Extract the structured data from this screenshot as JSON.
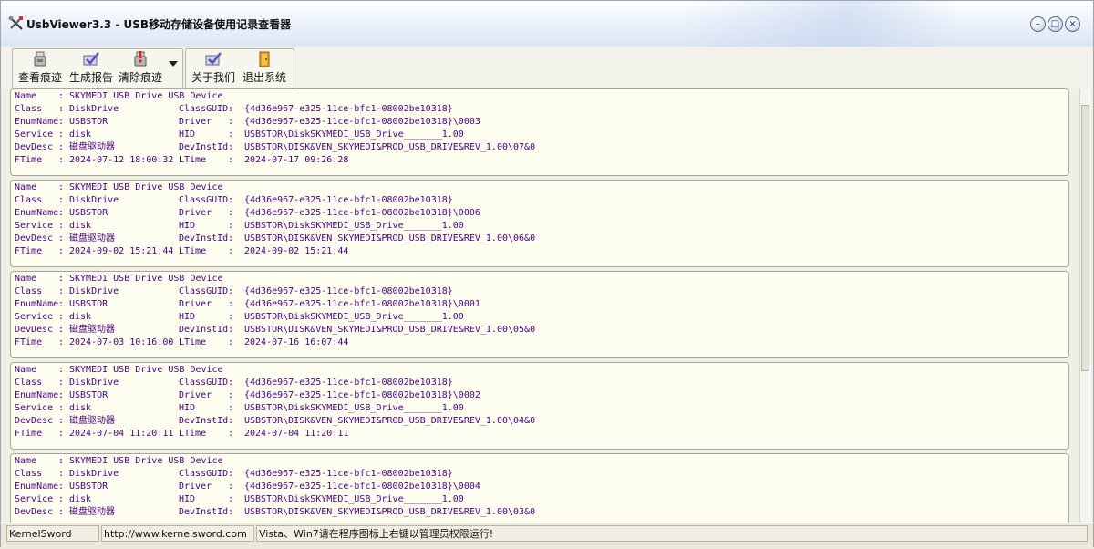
{
  "window": {
    "title": "UsbViewer3.3 - USB移动存储设备使用记录查看器"
  },
  "toolbar": {
    "buttons": [
      {
        "label": "查看痕迹",
        "icon": "usb-drive-icon"
      },
      {
        "label": "生成报告",
        "icon": "report-check-icon"
      },
      {
        "label": "清除痕迹",
        "icon": "clear-drive-icon"
      },
      {
        "label": "关于我们",
        "icon": "about-check-icon"
      },
      {
        "label": "退出系统",
        "icon": "exit-door-icon"
      }
    ]
  },
  "records": [
    {
      "lines": [
        [
          "Name",
          "SKYMEDI USB Drive USB Device",
          "",
          ""
        ],
        [
          "Class",
          "DiskDrive",
          "ClassGUID",
          "{4d36e967-e325-11ce-bfc1-08002be10318}"
        ],
        [
          "EnumName",
          "USBSTOR",
          "Driver",
          "{4d36e967-e325-11ce-bfc1-08002be10318}\\0003"
        ],
        [
          "Service",
          "disk",
          "HID",
          "USBSTOR\\DiskSKYMEDI_USB_Drive_______1.00"
        ],
        [
          "DevDesc",
          "磁盘驱动器",
          "DevInstId",
          "USBSTOR\\DISK&VEN_SKYMEDI&PROD_USB_DRIVE&REV_1.00\\07&0"
        ],
        [
          "FTime",
          "2024-07-12 18:00:32",
          "LTime",
          "2024-07-17 09:26:28"
        ]
      ]
    },
    {
      "lines": [
        [
          "Name",
          "SKYMEDI USB Drive USB Device",
          "",
          ""
        ],
        [
          "Class",
          "DiskDrive",
          "ClassGUID",
          "{4d36e967-e325-11ce-bfc1-08002be10318}"
        ],
        [
          "EnumName",
          "USBSTOR",
          "Driver",
          "{4d36e967-e325-11ce-bfc1-08002be10318}\\0006"
        ],
        [
          "Service",
          "disk",
          "HID",
          "USBSTOR\\DiskSKYMEDI_USB_Drive_______1.00"
        ],
        [
          "DevDesc",
          "磁盘驱动器",
          "DevInstId",
          "USBSTOR\\DISK&VEN_SKYMEDI&PROD_USB_DRIVE&REV_1.00\\06&0"
        ],
        [
          "FTime",
          "2024-09-02 15:21:44",
          "LTime",
          "2024-09-02 15:21:44"
        ]
      ]
    },
    {
      "lines": [
        [
          "Name",
          "SKYMEDI USB Drive USB Device",
          "",
          ""
        ],
        [
          "Class",
          "DiskDrive",
          "ClassGUID",
          "{4d36e967-e325-11ce-bfc1-08002be10318}"
        ],
        [
          "EnumName",
          "USBSTOR",
          "Driver",
          "{4d36e967-e325-11ce-bfc1-08002be10318}\\0001"
        ],
        [
          "Service",
          "disk",
          "HID",
          "USBSTOR\\DiskSKYMEDI_USB_Drive_______1.00"
        ],
        [
          "DevDesc",
          "磁盘驱动器",
          "DevInstId",
          "USBSTOR\\DISK&VEN_SKYMEDI&PROD_USB_DRIVE&REV_1.00\\05&0"
        ],
        [
          "FTime",
          "2024-07-03 10:16:00",
          "LTime",
          "2024-07-16 16:07:44"
        ]
      ]
    },
    {
      "lines": [
        [
          "Name",
          "SKYMEDI USB Drive USB Device",
          "",
          ""
        ],
        [
          "Class",
          "DiskDrive",
          "ClassGUID",
          "{4d36e967-e325-11ce-bfc1-08002be10318}"
        ],
        [
          "EnumName",
          "USBSTOR",
          "Driver",
          "{4d36e967-e325-11ce-bfc1-08002be10318}\\0002"
        ],
        [
          "Service",
          "disk",
          "HID",
          "USBSTOR\\DiskSKYMEDI_USB_Drive_______1.00"
        ],
        [
          "DevDesc",
          "磁盘驱动器",
          "DevInstId",
          "USBSTOR\\DISK&VEN_SKYMEDI&PROD_USB_DRIVE&REV_1.00\\04&0"
        ],
        [
          "FTime",
          "2024-07-04 11:20:11",
          "LTime",
          "2024-07-04 11:20:11"
        ]
      ]
    },
    {
      "lines": [
        [
          "Name",
          "SKYMEDI USB Drive USB Device",
          "",
          ""
        ],
        [
          "Class",
          "DiskDrive",
          "ClassGUID",
          "{4d36e967-e325-11ce-bfc1-08002be10318}"
        ],
        [
          "EnumName",
          "USBSTOR",
          "Driver",
          "{4d36e967-e325-11ce-bfc1-08002be10318}\\0004"
        ],
        [
          "Service",
          "disk",
          "HID",
          "USBSTOR\\DiskSKYMEDI_USB_Drive_______1.00"
        ],
        [
          "DevDesc",
          "磁盘驱动器",
          "DevInstId",
          "USBSTOR\\DISK&VEN_SKYMEDI&PROD_USB_DRIVE&REV_1.00\\03&0"
        ]
      ]
    }
  ],
  "statusbar": {
    "panel1": "KernelSword",
    "panel2": "http://www.kernelsword.com",
    "panel3": "Vista、Win7请在程序图标上右键以管理员权限运行!"
  },
  "colors": {
    "record_text": "#4b0082",
    "record_bg": "#fdfdf0"
  }
}
